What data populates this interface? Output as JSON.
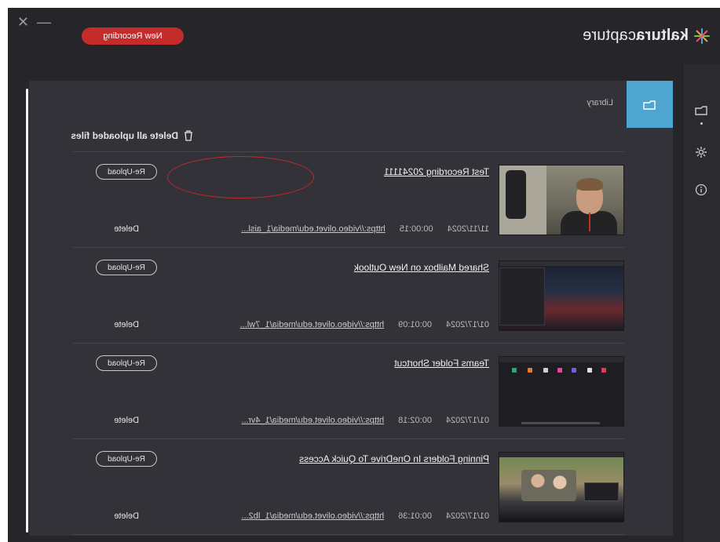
{
  "app": {
    "brand_light": "capture",
    "brand_bold": "kaltura",
    "new_recording_label": "New Recording",
    "window_controls": {
      "minimize": "—",
      "close": "✕"
    },
    "colors": {
      "accent": "#4ea5d0",
      "record": "#c42b2b"
    }
  },
  "sidebar": {
    "items": [
      {
        "name": "library",
        "icon": "folder-icon"
      },
      {
        "name": "settings",
        "icon": "gear-icon"
      },
      {
        "name": "info",
        "icon": "info-icon"
      }
    ]
  },
  "tab": {
    "label": "Library",
    "icon": "folder-icon"
  },
  "library": {
    "delete_all_label": "Delete all uploaded files",
    "reupload_label": "Re-Upload",
    "delete_label": "Delete",
    "recordings": [
      {
        "title": "Test Recording 20241111",
        "date": "11/11/2024",
        "duration": "00:00:15",
        "url": "https://video.olivet.edu/media/1_aisl..."
      },
      {
        "title": "Shared Mailbox on New Outlook",
        "date": "01/17/2024",
        "duration": "00:01:09",
        "url": "https://video.olivet.edu/media/1_7wl..."
      },
      {
        "title": "Teams Folder Shortcut",
        "date": "01/17/2024",
        "duration": "00:02:18",
        "url": "https://video.olivet.edu/media/1_4vr..."
      },
      {
        "title": "Pinning Folders In OneDrive To Quick Access",
        "date": "01/17/2024",
        "duration": "00:01:36",
        "url": "https://video.olivet.edu/media/1_lb2..."
      }
    ]
  }
}
